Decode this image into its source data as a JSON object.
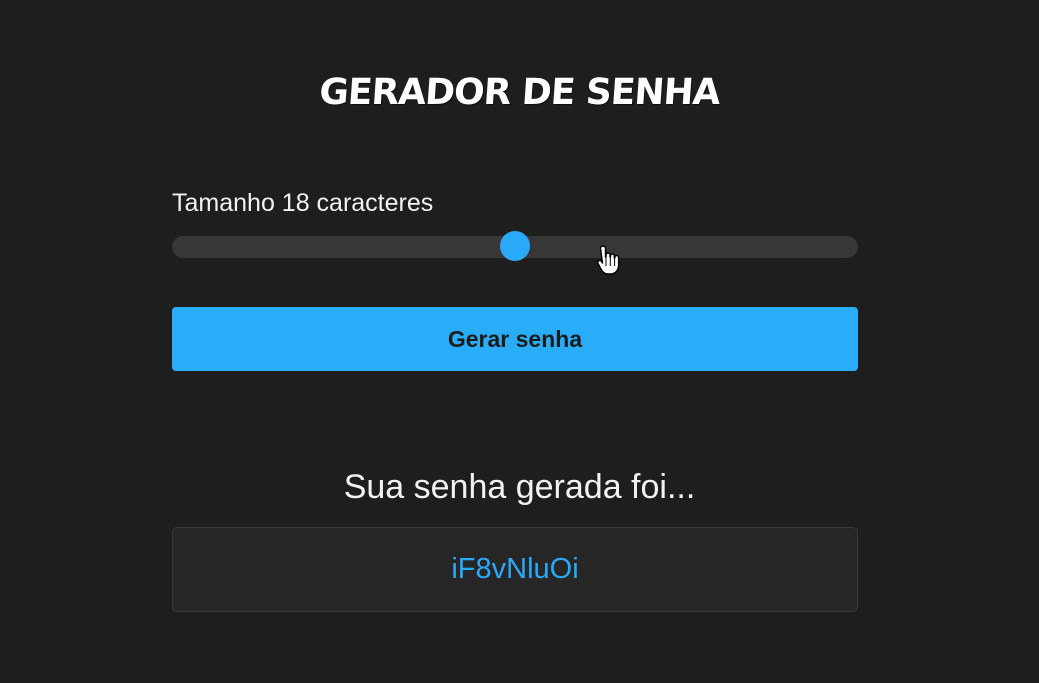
{
  "title": "GERADOR DE SENHA",
  "size": {
    "label": "Tamanho 18 caracteres",
    "value": 18,
    "min": 8,
    "max": 28
  },
  "generate": {
    "label": "Gerar senha"
  },
  "result": {
    "heading": "Sua senha gerada foi...",
    "password": "iF8vNluOi"
  },
  "colors": {
    "background": "#1e1e1f",
    "accent": "#29adf8",
    "track": "#373738",
    "result_box": "#262627"
  },
  "icons": {
    "cursor": "hand-pointer-icon"
  }
}
